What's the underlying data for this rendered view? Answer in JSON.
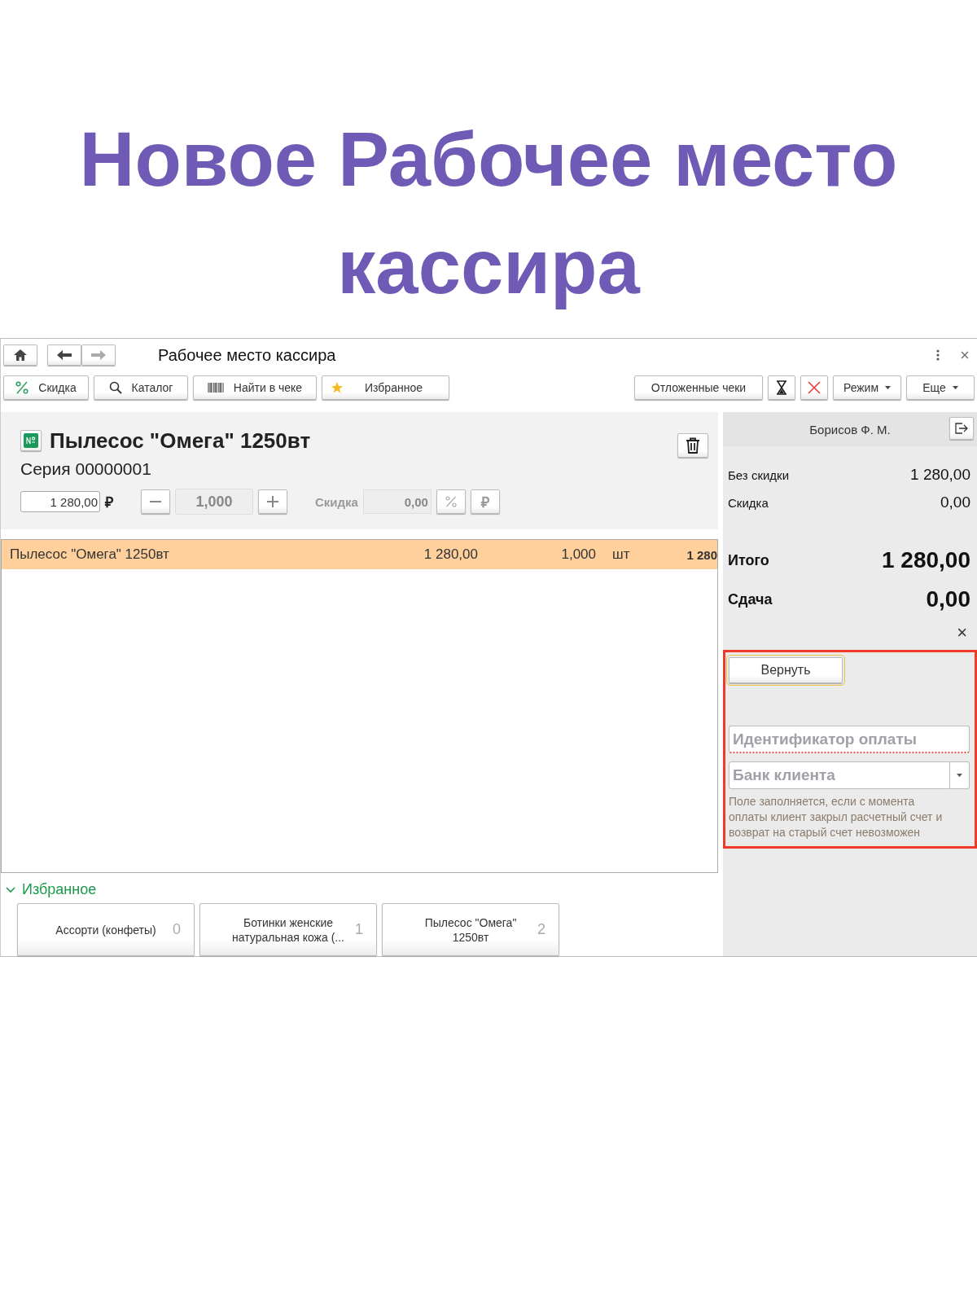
{
  "headline": "Новое Рабочее место кассира",
  "window": {
    "title": "Рабочее место кассира"
  },
  "toolbar_left": [
    {
      "kind": "discount",
      "label": "Скидка"
    },
    {
      "kind": "search",
      "label": "Каталог"
    },
    {
      "kind": "barcode",
      "label": "Найти в чеке"
    },
    {
      "kind": "star",
      "label": "Избранное"
    }
  ],
  "toolbar_right": [
    {
      "kind": "text",
      "label": "Отложенные чеки"
    },
    {
      "kind": "hourglass"
    },
    {
      "kind": "cancel"
    },
    {
      "kind": "dropdown",
      "label": "Режим"
    },
    {
      "kind": "dropdown",
      "label": "Еще"
    }
  ],
  "product": {
    "name": "Пылесос \"Омега\" 1250вт",
    "series": "Серия 00000001",
    "price": "1 280,00",
    "currency": "₽",
    "quantity": "1,000",
    "discount_label": "Скидка",
    "discount": "0,00",
    "currency_button": "₽"
  },
  "receipt_rows": [
    {
      "name": "Пылесос \"Омега\" 1250вт",
      "price": "1 280,00",
      "quantity": "1,000",
      "unit": "шт",
      "sum": "1 280",
      "selected": true
    }
  ],
  "favorites": {
    "title": "Избранное",
    "expanded": true,
    "items": [
      {
        "label": "Ассорти (конфеты)",
        "count": "0"
      },
      {
        "label": "Ботинки женские натуральная кожа (...",
        "count": "1"
      },
      {
        "label": "Пылесос \"Омега\" 1250вт",
        "count": "2"
      }
    ]
  },
  "cashier": "Борисов Ф. М.",
  "totals": [
    {
      "kind": "small",
      "label": "Без скидки",
      "value": "1 280,00"
    },
    {
      "kind": "small",
      "label": "Скидка",
      "value": "0,00"
    },
    {
      "kind": "big",
      "label": "Итого",
      "value": "1 280,00"
    },
    {
      "kind": "big",
      "label": "Сдача",
      "value": "0,00"
    }
  ],
  "close_glyph": "×",
  "return_panel": {
    "button": "Вернуть",
    "payment_id": {
      "placeholder": "Идентификатор оплаты"
    },
    "bank": {
      "placeholder": "Банк клиента"
    },
    "hint": "Поле заполняется, если с момента оплаты клиент закрыл расчетный счет и возврат на старый счет невозможен"
  }
}
